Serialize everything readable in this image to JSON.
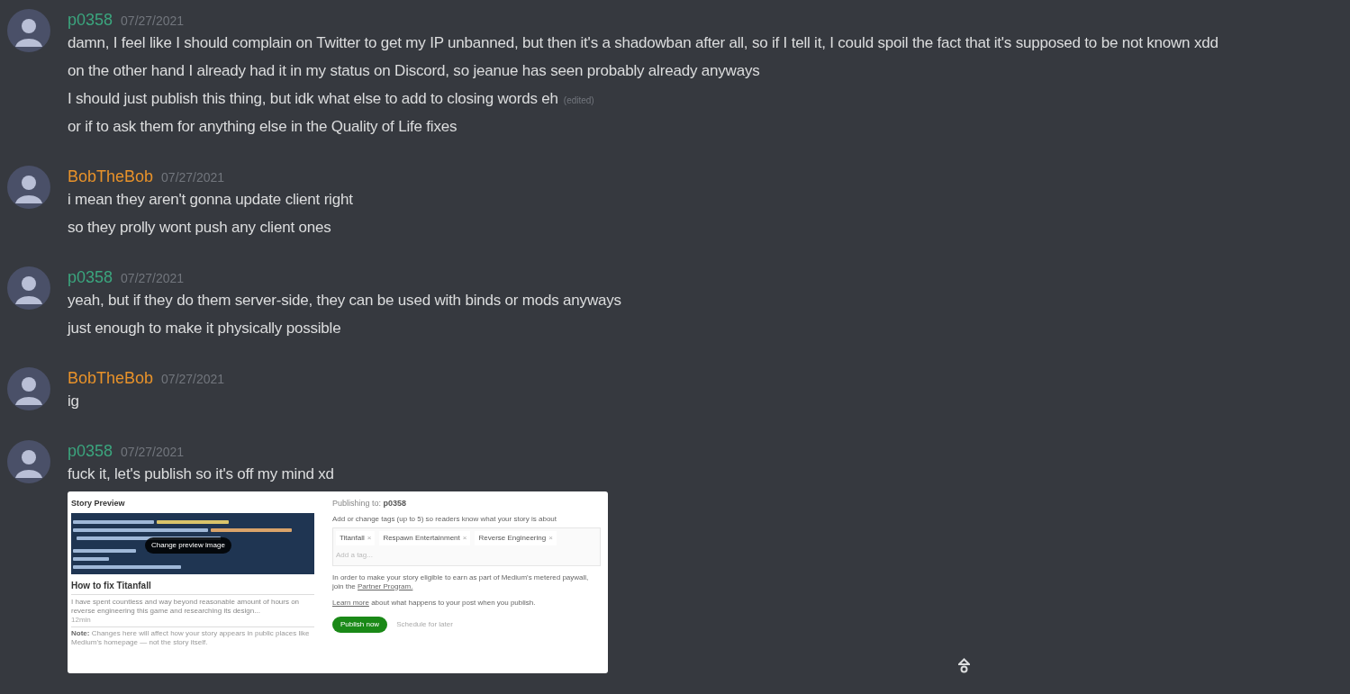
{
  "messages": [
    {
      "author": "p0358",
      "color": "#3ba57e",
      "timestamp": "07/27/2021",
      "lines": [
        {
          "text": "damn, I feel like I should complain on Twitter to get my IP unbanned, but then it's a shadowban after all, so if I tell it, I could spoil the fact that it's supposed to be not known xdd"
        },
        {
          "text": "on the other hand I already had it in my status on Discord, so jeanue has seen probably already anyways"
        },
        {
          "text": "I should just publish this thing, but idk what else to add to closing words eh",
          "edited_label": "(edited)"
        },
        {
          "text": "or if to ask them for anything else in the Quality of Life fixes"
        }
      ]
    },
    {
      "author": "BobTheBob",
      "color": "#e8922a",
      "timestamp": "07/27/2021",
      "lines": [
        {
          "text": "i mean they aren't gonna update client right"
        },
        {
          "text": "so they prolly wont push any client ones"
        }
      ]
    },
    {
      "author": "p0358",
      "color": "#3ba57e",
      "timestamp": "07/27/2021",
      "lines": [
        {
          "text": "yeah, but if they do them server-side, they can be used with binds or mods anyways"
        },
        {
          "text": "just enough to make it physically possible"
        }
      ]
    },
    {
      "author": "BobTheBob",
      "color": "#e8922a",
      "timestamp": "07/27/2021",
      "lines": [
        {
          "text": "ig"
        }
      ]
    },
    {
      "author": "p0358",
      "color": "#3ba57e",
      "timestamp": "07/27/2021",
      "lines": [
        {
          "text": "fuck it, let's publish so it's off my mind xd"
        }
      ],
      "attachment": {
        "kind": "screenshot",
        "left": {
          "title": "Story Preview",
          "overlay_button": "Change preview image",
          "story_title": "How to fix Titanfall",
          "excerpt": "I have spent countless and way beyond reasonable amount of hours on reverse engineering this game and researching its design...",
          "read_time": "12min",
          "note_label": "Note:",
          "note": "Changes here will affect how your story appears in public places like Medium's homepage — not the story itself."
        },
        "right": {
          "publishing_label": "Publishing to:",
          "publication": "p0358",
          "tags_hint": "Add or change tags (up to 5) so readers know what your story is about",
          "tags": [
            {
              "label": "Titanfall",
              "remove": "×"
            },
            {
              "label": "Respawn Entertainment",
              "remove": "×"
            },
            {
              "label": "Reverse Engineering",
              "remove": "×"
            }
          ],
          "tag_placeholder": "Add a tag...",
          "partner_text": "In order to make your story eligible to earn as part of Medium's metered paywall, join the",
          "partner_link": "Partner Program.",
          "learn_link": "Learn more",
          "learn_text": "about what happens to your post when you publish.",
          "publish_button": "Publish now",
          "schedule_button": "Schedule for later"
        }
      }
    }
  ]
}
